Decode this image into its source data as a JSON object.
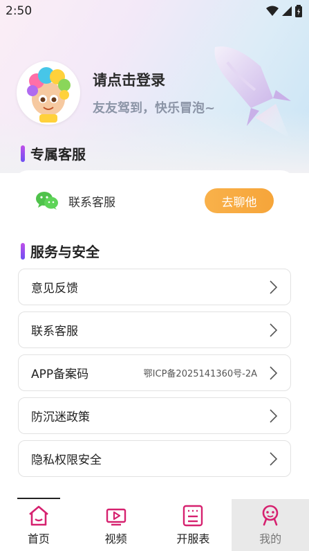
{
  "status_bar": {
    "time": "2:50"
  },
  "profile": {
    "login_prompt": "请点击登录",
    "slogan": "友友驾到，快乐冒泡~"
  },
  "sections": {
    "service_title": "专属客服",
    "security_title": "服务与安全"
  },
  "service_card": {
    "label": "联系客服",
    "button_label": "去聊他"
  },
  "menu_items": [
    {
      "label": "意见反馈",
      "value": ""
    },
    {
      "label": "联系客服",
      "value": ""
    },
    {
      "label": "APP备案码",
      "value": "鄂ICP备2025141360号-2A"
    },
    {
      "label": "防沉迷政策",
      "value": ""
    },
    {
      "label": "隐私权限安全",
      "value": ""
    }
  ],
  "tabs": [
    {
      "label": "首页",
      "icon": "home-icon"
    },
    {
      "label": "视频",
      "icon": "video-icon"
    },
    {
      "label": "开服表",
      "icon": "schedule-icon"
    },
    {
      "label": "我的",
      "icon": "profile-icon"
    }
  ],
  "colors": {
    "accent_pink": "#d6216f",
    "button_orange": "#f6a53a",
    "section_bar_top": "#c04fe9",
    "section_bar_bottom": "#6d4ff2"
  }
}
